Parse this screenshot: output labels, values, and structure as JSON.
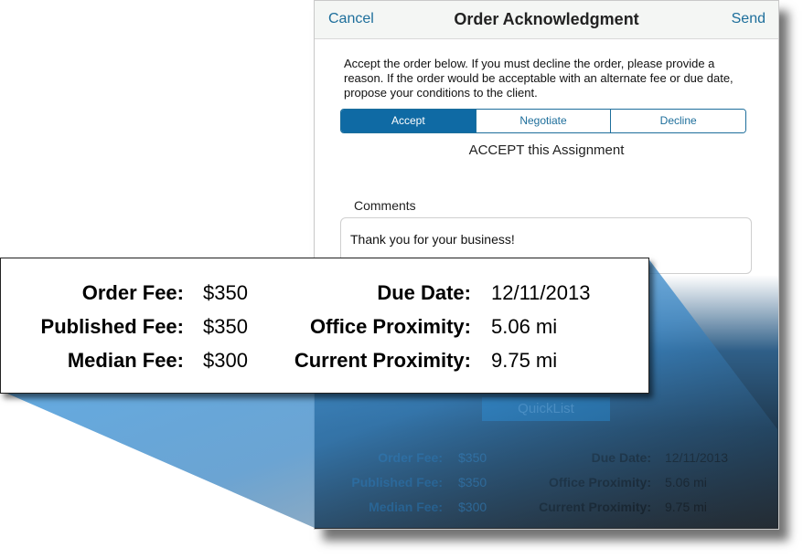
{
  "navbar": {
    "cancel": "Cancel",
    "title": "Order Acknowledgment",
    "send": "Send"
  },
  "instructions": "Accept the order below.  If you must decline the order, please provide a reason.  If the order would be acceptable with an alternate fee or due date, propose your conditions to the client.",
  "segments": [
    "Accept",
    "Negotiate",
    "Decline"
  ],
  "selected_segment": "Accept",
  "status_text": "ACCEPT this Assignment",
  "comments": {
    "label": "Comments",
    "value": "Thank you for your business!"
  },
  "quicklist_label": "QuickList",
  "fees": {
    "order_fee_label": "Order Fee:",
    "order_fee": "$350",
    "published_fee_label": "Published Fee:",
    "published_fee": "$350",
    "median_fee_label": "Median Fee:",
    "median_fee": "$300",
    "due_date_label": "Due Date:",
    "due_date": "12/11/2013",
    "office_proximity_label": "Office Proximity:",
    "office_proximity": "5.06 mi",
    "current_proximity_label": "Current Proximity:",
    "current_proximity": "9.75 mi"
  },
  "colors": {
    "accent": "#1d6e9b",
    "segment_active": "#0f6aa4",
    "beam": "#4aa3e8"
  }
}
